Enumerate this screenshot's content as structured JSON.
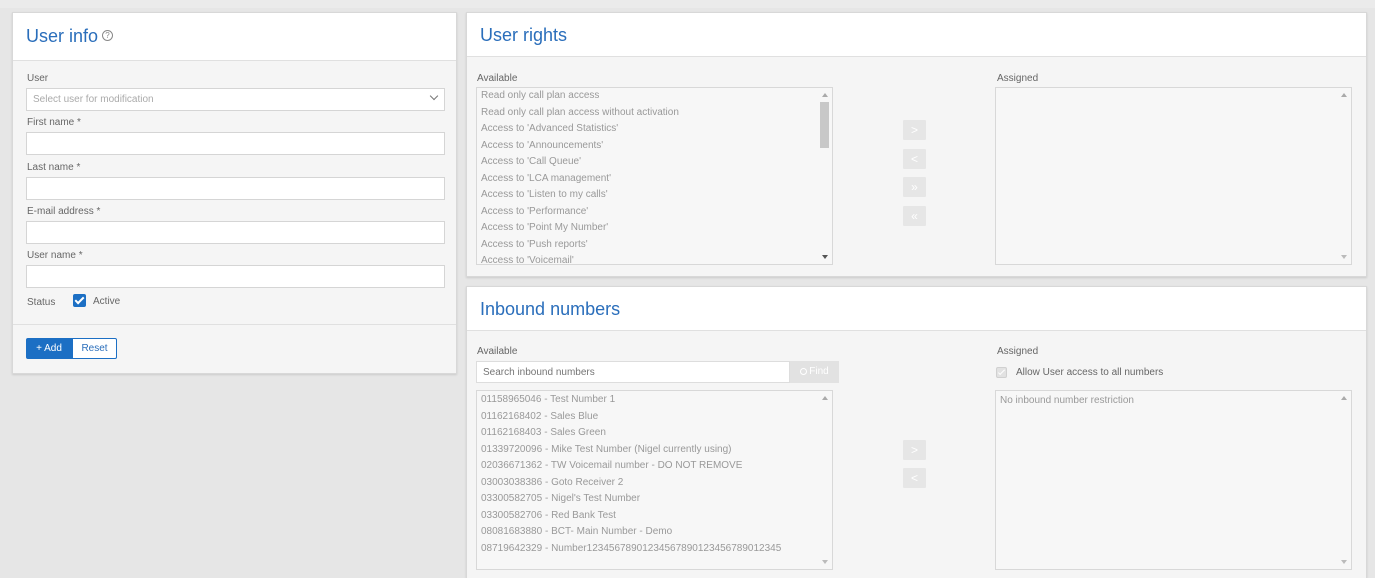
{
  "user_info": {
    "title": "User info",
    "help_icon": "?",
    "user_label": "User",
    "user_select_placeholder": "Select user for modification",
    "first_name_label": "First name",
    "last_name_label": "Last name",
    "email_label": "E-mail address",
    "username_label": "User name",
    "required_mark": "*",
    "first_name_value": "",
    "last_name_value": "",
    "email_value": "",
    "username_value": "",
    "status_label": "Status",
    "active_label": "Active",
    "active_checked": true,
    "add_button": "+ Add",
    "reset_button": "Reset"
  },
  "user_rights": {
    "title": "User rights",
    "available_label": "Available",
    "assigned_label": "Assigned",
    "available_items": [
      "Read only call plan access",
      "Read only call plan access without activation",
      "Access to 'Advanced Statistics'",
      "Access to 'Announcements'",
      "Access to 'Call Queue'",
      "Access to 'LCA management'",
      "Access to 'Listen to my calls'",
      "Access to 'Performance'",
      "Access to 'Point My Number'",
      "Access to 'Push reports'",
      "Access to 'Voicemail'"
    ],
    "move_buttons": [
      ">",
      "<",
      "»",
      "«"
    ]
  },
  "inbound_numbers": {
    "title": "Inbound numbers",
    "available_label": "Available",
    "assigned_label": "Assigned",
    "search_placeholder": "Search inbound numbers",
    "find_button": "Find",
    "allow_all_label": "Allow User access to all numbers",
    "no_restriction_text": "No inbound number restriction",
    "available_items": [
      "01158965046 - Test Number 1",
      "01162168402 - Sales Blue",
      "01162168403 - Sales Green",
      "01339720096 - Mike Test Number (Nigel currently using)",
      "02036671362 - TW Voicemail number - DO NOT REMOVE",
      "03003038386 - Goto Receiver 2",
      "03300582705 - Nigel's Test Number",
      "03300582706 - Red Bank Test",
      "08081683880 - BCT- Main Number - Demo",
      "08719642329 - Number12345678901234567890123456789012345"
    ],
    "move_buttons": [
      ">",
      "<"
    ]
  }
}
